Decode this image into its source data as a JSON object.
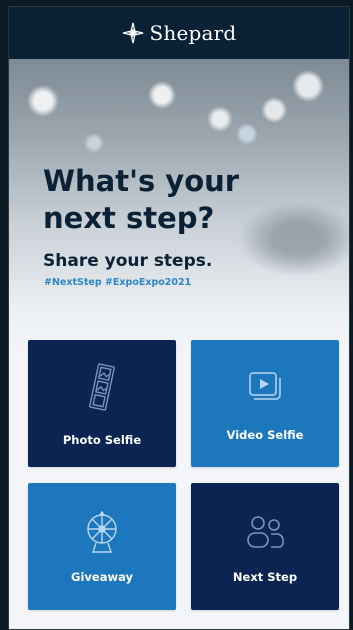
{
  "header": {
    "brand": "Shepard",
    "logo_icon": "diamond-star-logo"
  },
  "hero": {
    "title_line1": "What's your",
    "title_line2": "next step?",
    "subtitle": "Share your steps.",
    "hashtags": "#NextStep #ExpoExpo2021"
  },
  "tiles": [
    {
      "label": "Photo Selfie",
      "icon": "photo-strip-icon",
      "color": "#0b2452"
    },
    {
      "label": "Video Selfie",
      "icon": "video-play-icon",
      "color": "#1d77bc"
    },
    {
      "label": "Giveaway",
      "icon": "prize-wheel-icon",
      "color": "#1d77bc"
    },
    {
      "label": "Next Step",
      "icon": "people-icon",
      "color": "#0b2452"
    }
  ],
  "colors": {
    "header_bg": "#0b2136",
    "dark_tile": "#0b2452",
    "light_tile": "#1d77bc",
    "hashtag": "#2f87c5"
  }
}
